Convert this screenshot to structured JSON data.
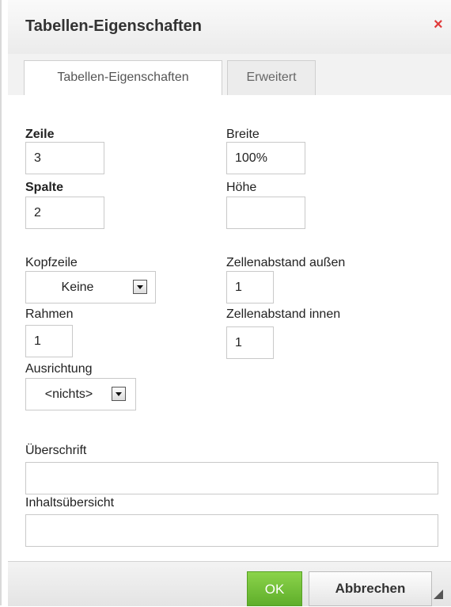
{
  "dialog": {
    "title": "Tabellen-Eigenschaften",
    "close_symbol": "×"
  },
  "tabs": [
    {
      "label": "Tabellen-Eigenschaften",
      "active": true
    },
    {
      "label": "Erweitert",
      "active": false
    }
  ],
  "form": {
    "rows_label": "Zeile",
    "rows_value": "3",
    "cols_label": "Spalte",
    "cols_value": "2",
    "width_label": "Breite",
    "width_value": "100%",
    "height_label": "Höhe",
    "height_value": "",
    "header_label": "Kopfzeile",
    "header_value": "Keine",
    "border_label": "Rahmen",
    "border_value": "1",
    "align_label": "Ausrichtung",
    "align_value": "<nichts>",
    "cellspacing_label": "Zellenabstand außen",
    "cellspacing_value": "1",
    "cellpadding_label": "Zellenabstand innen",
    "cellpadding_value": "1",
    "caption_label": "Überschrift",
    "caption_value": "",
    "summary_label": "Inhaltsübersicht",
    "summary_value": ""
  },
  "footer": {
    "ok_label": "OK",
    "cancel_label": "Abbrechen"
  },
  "colors": {
    "ok_green": "#6cbd33",
    "close_red": "#e03a3a"
  }
}
